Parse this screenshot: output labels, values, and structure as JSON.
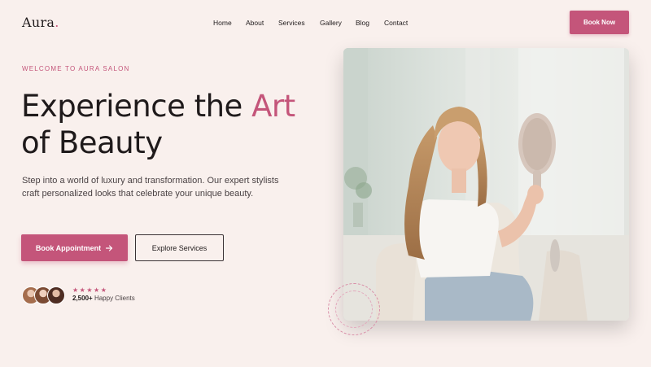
{
  "nav": {
    "logo": "Aura",
    "logo_dot": ".",
    "links": [
      "Home",
      "About",
      "Services",
      "Gallery",
      "Blog",
      "Contact"
    ],
    "cta": "Book Now"
  },
  "hero": {
    "eyebrow": "WELCOME TO AURA SALON",
    "headline_part1": "Experience the ",
    "headline_accent": "Art",
    "headline_part2": "of Beauty",
    "description": "Step into a world of luxury and transformation. Our expert stylists craft personalized looks that celebrate your unique beauty.",
    "primary_button": "Book Appointment",
    "primary_button_icon": "arrow-right-icon",
    "secondary_button": "Explore Services",
    "rating_stars": "★★★★★",
    "clients_count": "2,500+",
    "clients_label": "Happy Clients"
  },
  "colors": {
    "accent": "#c4557a",
    "background": "#f9f0ed",
    "text": "#1f1a1b"
  }
}
